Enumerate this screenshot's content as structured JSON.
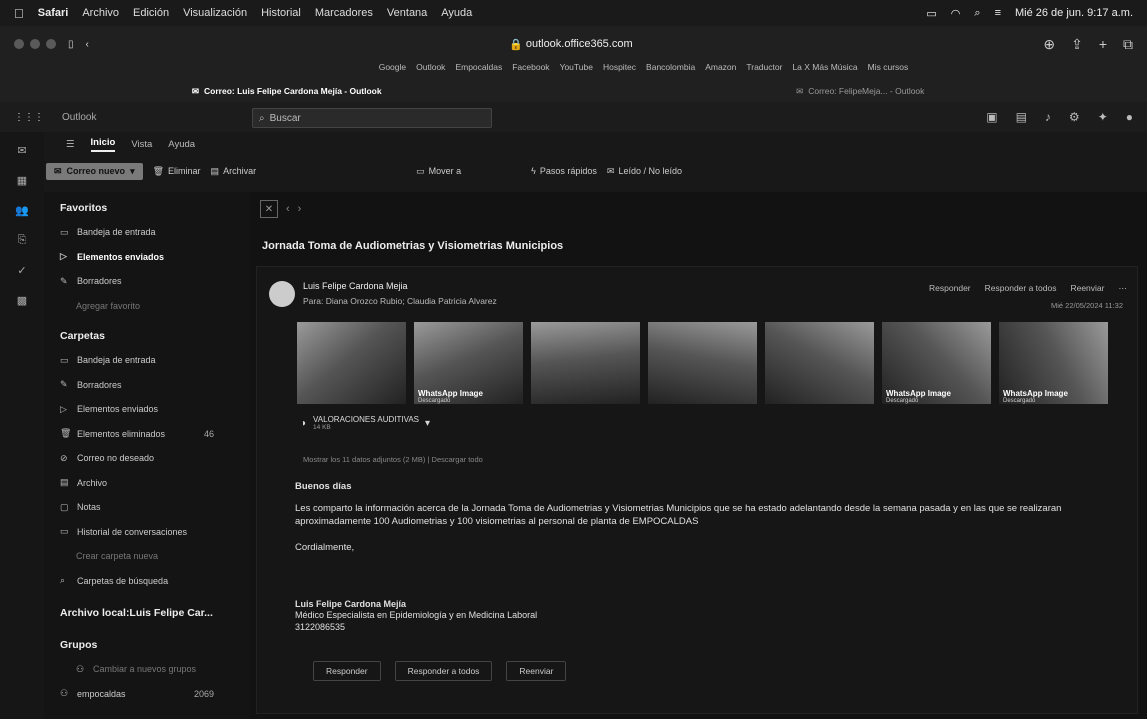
{
  "macmenu": {
    "apple": "",
    "app": "Safari",
    "items": [
      "Archivo",
      "Edición",
      "Visualización",
      "Historial",
      "Marcadores",
      "Ventana",
      "Ayuda"
    ],
    "clock": "Mié 26 de jun. 9:17 a.m."
  },
  "browser": {
    "url": "outlook.office365.com",
    "favorites": [
      "Google",
      "Outlook",
      "Empocaldas",
      "Facebook",
      "YouTube",
      "Hospitec",
      "Bancolombia",
      "Amazon",
      "Traductor",
      "La X Más Música",
      "Mis cursos"
    ],
    "tab_active": "Correo: Luis Felipe Cardona Mejía - Outlook",
    "tab_inactive": "Correo: FelipeMeja... - Outlook"
  },
  "outlook": {
    "brand": "Outlook",
    "search_placeholder": "Buscar",
    "ribbon_tabs": [
      "Inicio",
      "Vista",
      "Ayuda"
    ],
    "new_mail": "Correo nuevo",
    "commands": [
      "Eliminar",
      "Archivar",
      "Mover a",
      "Pasos rápidos",
      "Leído / No leído"
    ]
  },
  "folders": {
    "favorites_title": "Favoritos",
    "favorites": [
      {
        "label": "Bandeja de entrada",
        "icon": "inbox-icon",
        "bold": false,
        "dim": false
      },
      {
        "label": "Elementos enviados",
        "icon": "send-icon",
        "bold": true,
        "dim": false
      },
      {
        "label": "Borradores",
        "icon": "pencil-icon",
        "bold": false,
        "dim": false
      },
      {
        "label": "Agregar favorito",
        "icon": "",
        "bold": false,
        "dim": true
      }
    ],
    "folders_title": "Carpetas",
    "folders": [
      {
        "label": "Bandeja de entrada",
        "icon": "inbox-icon",
        "count": "",
        "dim": false
      },
      {
        "label": "Borradores",
        "icon": "pencil-icon",
        "count": "",
        "dim": false
      },
      {
        "label": "Elementos enviados",
        "icon": "send-icon",
        "count": "",
        "dim": false
      },
      {
        "label": "Elementos eliminados",
        "icon": "trash-icon",
        "count": "46",
        "dim": false
      },
      {
        "label": "Correo no deseado",
        "icon": "junk-icon",
        "count": "",
        "dim": false
      },
      {
        "label": "Archivo",
        "icon": "archive-icon",
        "count": "",
        "dim": false
      },
      {
        "label": "Notas",
        "icon": "note-icon",
        "count": "",
        "dim": false
      },
      {
        "label": "Historial de conversaciones",
        "icon": "folder-icon",
        "count": "",
        "dim": false
      },
      {
        "label": "Crear carpeta nueva",
        "icon": "",
        "count": "",
        "dim": true
      },
      {
        "label": "Carpetas de búsqueda",
        "icon": "search-folder-icon",
        "count": "",
        "dim": false
      }
    ],
    "archive_title": "Archivo local:Luis Felipe Car...",
    "groups_title": "Grupos",
    "groups": [
      {
        "label": "Cambiar a nuevos grupos",
        "icon": "groups-icon",
        "count": "",
        "dim": true
      },
      {
        "label": "empocaldas",
        "icon": "groups-icon",
        "count": "2069",
        "dim": false
      }
    ]
  },
  "message": {
    "subject": "Jornada Toma de Audiometrias y Visiometrias Municipios",
    "sender": "Luis Felipe Cardona Mejia",
    "to_label": "Para:",
    "to": "Diana Orozco Rubio; Claudia Patricia Alvarez",
    "date": "Mié 22/05/2024 11:32",
    "actions": [
      "Responder",
      "Responder a todos",
      "Reenviar"
    ],
    "thumbs": [
      {
        "caption": "",
        "sub": ""
      },
      {
        "caption": "WhatsApp Image",
        "sub": "Descargado"
      },
      {
        "caption": "",
        "sub": ""
      },
      {
        "caption": "",
        "sub": ""
      },
      {
        "caption": "",
        "sub": ""
      },
      {
        "caption": "WhatsApp Image",
        "sub": "Descargado"
      },
      {
        "caption": "WhatsApp Image",
        "sub": "Descargado"
      }
    ],
    "attachment_name": "VALORACIONES AUDITIVAS",
    "attachment_size": "14 KB",
    "show_all": "Mostrar los 11 datos adjuntos (2 MB)",
    "download_all": "Descargar todo",
    "greeting": "Buenos días",
    "paragraph": "Les comparto la información acerca de la Jornada Toma de Audiometrias y Visiometrias Municipios que se ha estado adelantando desde la semana pasada y en las que se realizaran aproximadamente 100 Audiometrias y 100 visiometrias al personal de planta de EMPOCALDAS",
    "closing": "Cordialmente,",
    "sig_name": "Luis Felipe Cardona Mejía",
    "sig_title": "Médico Especialista en Epidemiología y en Medicina Laboral",
    "sig_phone": "3122086535",
    "reply_buttons": [
      "Responder",
      "Responder a todos",
      "Reenviar"
    ]
  }
}
